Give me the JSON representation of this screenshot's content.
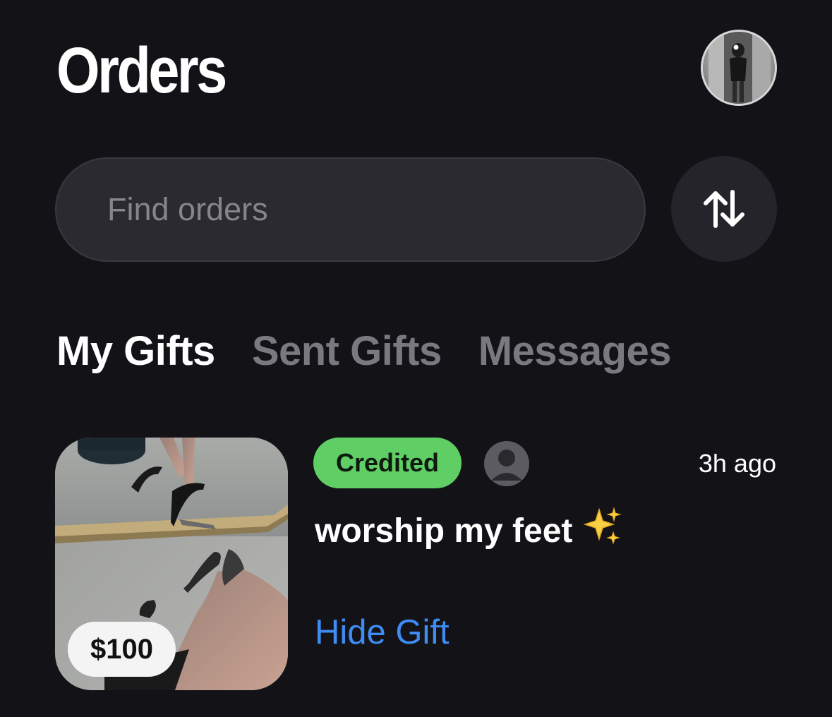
{
  "header": {
    "title": "Orders",
    "avatar_icon": "profile-photo"
  },
  "search": {
    "placeholder": "Find orders",
    "value": ""
  },
  "sort": {
    "icon": "sort-arrows-icon"
  },
  "tabs": [
    {
      "label": "My Gifts",
      "active": true
    },
    {
      "label": "Sent Gifts",
      "active": false
    },
    {
      "label": "Messages",
      "active": false
    }
  ],
  "orders": [
    {
      "price": "$100",
      "status": "Credited",
      "time": "3h ago",
      "title": "worship my feet",
      "title_emoji": "sparkles-icon",
      "action": "Hide Gift",
      "thumbnail_icon": "gift-photo"
    }
  ],
  "colors": {
    "background": "#131217",
    "status_green": "#5fcf65",
    "link_blue": "#3e8cf4",
    "inactive_tab": "#7a797f"
  }
}
